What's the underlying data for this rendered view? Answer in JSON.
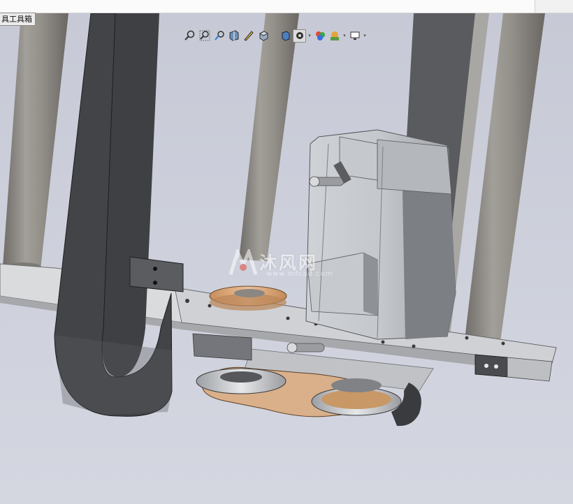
{
  "toolbox_tab": {
    "label": "Toolbox",
    "display_label": "具工具箱"
  },
  "watermark": {
    "brand": "沐风网",
    "url": "www.mfcad.com"
  },
  "heads_up_toolbar": {
    "buttons": [
      {
        "icon": "zoom-to-fit-icon"
      },
      {
        "icon": "zoom-to-area-icon"
      },
      {
        "icon": "previous-view-icon"
      },
      {
        "icon": "section-view-icon"
      },
      {
        "icon": "dynamic-annotation-icon"
      },
      {
        "icon": "view-orientation-icon"
      },
      {
        "icon": "display-style-icon"
      },
      {
        "icon": "hide-show-items-icon"
      },
      {
        "icon": "edit-appearance-icon"
      },
      {
        "icon": "apply-scene-icon"
      },
      {
        "icon": "view-settings-icon"
      }
    ]
  },
  "colors": {
    "background": "#c8ccd8",
    "steel": "#b9bcc0",
    "dark_steel": "#4a4b4e",
    "rod": "#8f8c86",
    "copper": "#d9a77a",
    "plate": "#d7d9dc"
  }
}
